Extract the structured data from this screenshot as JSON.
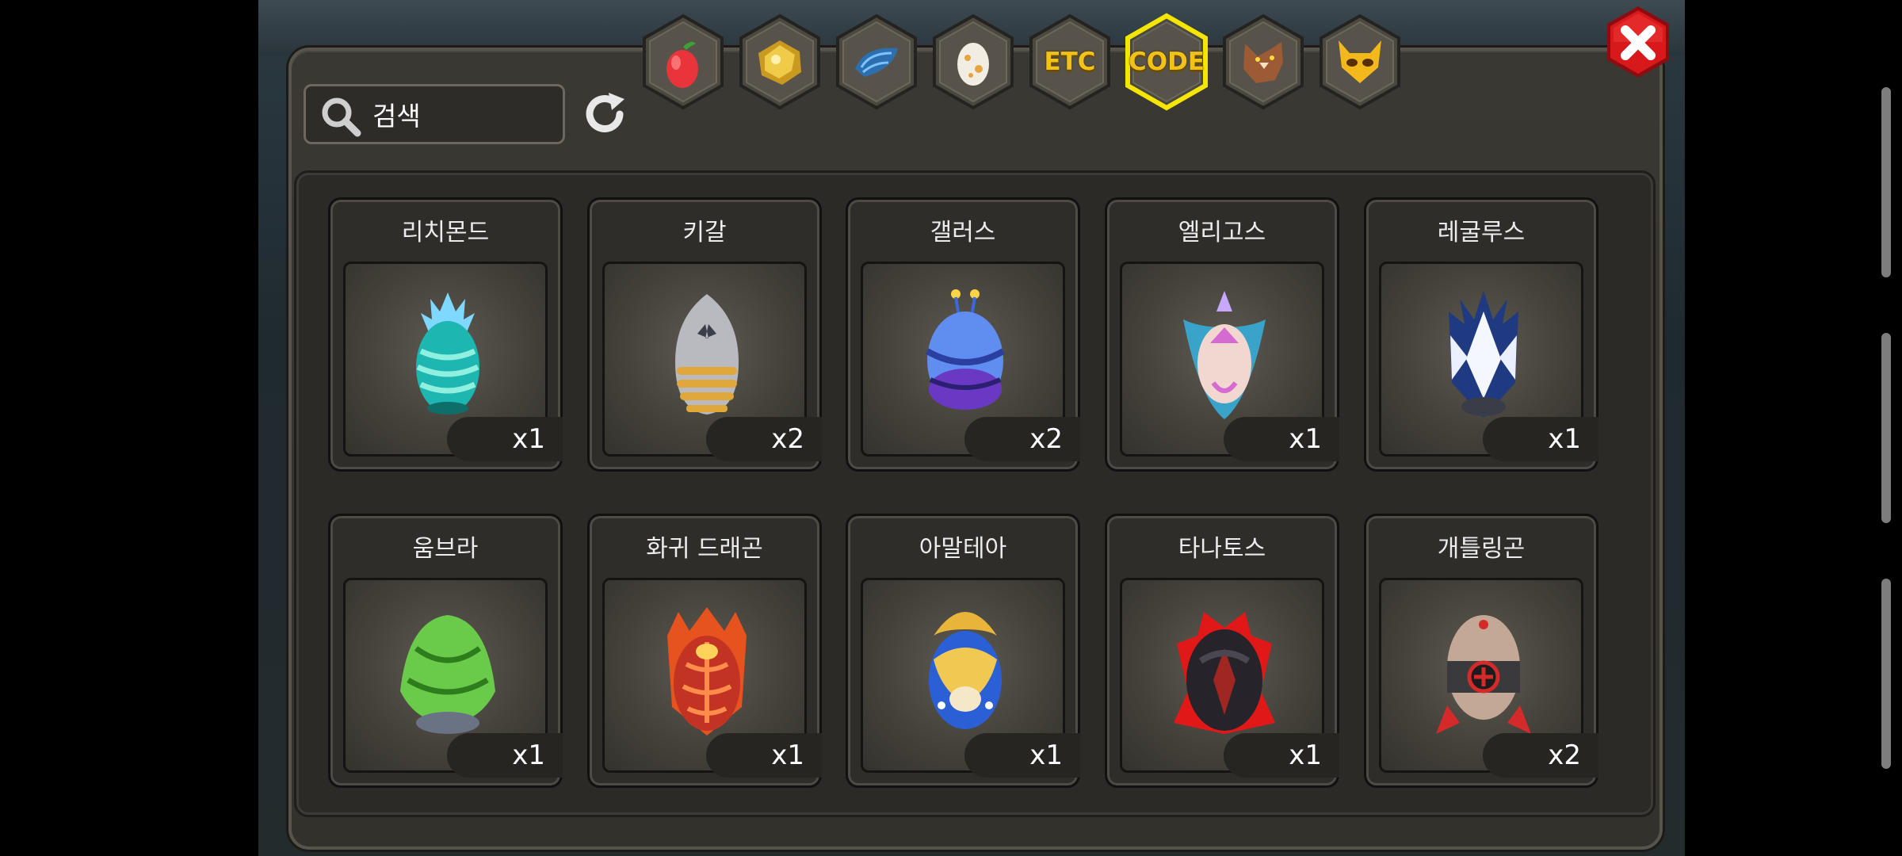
{
  "search": {
    "placeholder": "검색",
    "value": ""
  },
  "tabs": [
    {
      "id": "fruit",
      "icon": "fruit-icon",
      "label": ""
    },
    {
      "id": "gold",
      "icon": "gold-ore-icon",
      "label": ""
    },
    {
      "id": "scale",
      "icon": "dragon-scale-icon",
      "label": ""
    },
    {
      "id": "egg",
      "icon": "egg-icon",
      "label": ""
    },
    {
      "id": "etc",
      "icon": "",
      "label": "ETC"
    },
    {
      "id": "code",
      "icon": "",
      "label": "CODE",
      "selected": true
    },
    {
      "id": "wolf",
      "icon": "wolf-head-icon",
      "label": ""
    },
    {
      "id": "mask",
      "icon": "devil-mask-icon",
      "label": ""
    }
  ],
  "colors": {
    "tab_label": "#f3c219",
    "tab_selected_border": "#f5e600",
    "close_button": "#d8191c"
  },
  "items": [
    {
      "name": "리치몬드",
      "qty": "x1",
      "egg": "crystal-teal"
    },
    {
      "name": "키갈",
      "qty": "x2",
      "egg": "silver-gold"
    },
    {
      "name": "갤러스",
      "qty": "x2",
      "egg": "blue-purple"
    },
    {
      "name": "엘리고스",
      "qty": "x1",
      "egg": "pink-winged"
    },
    {
      "name": "레굴루스",
      "qty": "x1",
      "egg": "blue-white-spiked"
    },
    {
      "name": "움브라",
      "qty": "x1",
      "egg": "green-leaf"
    },
    {
      "name": "화귀 드래곤",
      "qty": "x1",
      "egg": "red-flame"
    },
    {
      "name": "아말테아",
      "qty": "x1",
      "egg": "gold-blue"
    },
    {
      "name": "타나토스",
      "qty": "x1",
      "egg": "dark-red"
    },
    {
      "name": "개틀링곤",
      "qty": "x2",
      "egg": "mech"
    }
  ]
}
